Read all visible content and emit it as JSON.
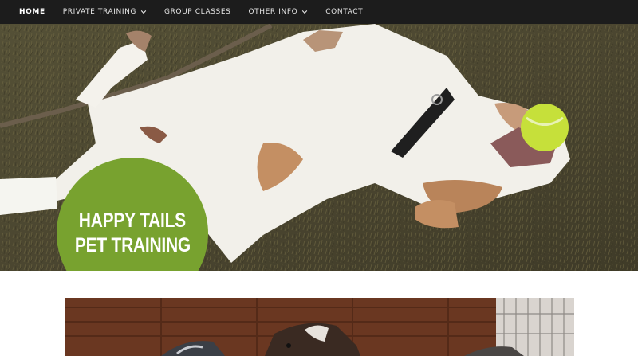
{
  "nav": {
    "items": [
      {
        "label": "HOME",
        "active": true,
        "has_dropdown": false
      },
      {
        "label": "PRIVATE TRAINING",
        "active": false,
        "has_dropdown": true
      },
      {
        "label": "GROUP CLASSES",
        "active": false,
        "has_dropdown": false
      },
      {
        "label": "OTHER INFO",
        "active": false,
        "has_dropdown": true
      },
      {
        "label": "CONTACT",
        "active": false,
        "has_dropdown": false
      }
    ],
    "background": "#1c1c1c"
  },
  "hero": {
    "image": "dog-rolling-on-grass-with-tennis-ball",
    "badge": {
      "line1": "HAPPY TAILS",
      "line2": "PET TRAINING",
      "color": "#78a22f"
    }
  },
  "gallery": {
    "image": "dogs-by-wooden-fence"
  }
}
